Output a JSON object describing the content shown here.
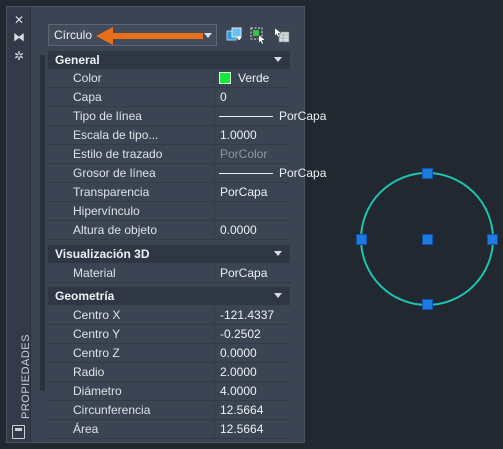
{
  "palette": {
    "title": "PROPIEDADES",
    "selector": {
      "value": "Círculo"
    },
    "toolbar_icons": [
      "close-icon",
      "auto-hide-icon",
      "settings-icon",
      "quick-select-icon",
      "select-objects-icon",
      "toggle-pickadd-icon"
    ],
    "sections": [
      {
        "label": "General",
        "rows": [
          {
            "name": "Color",
            "value": "Verde"
          },
          {
            "name": "Capa",
            "value": "0"
          },
          {
            "name": "Tipo de línea",
            "value": "PorCapa"
          },
          {
            "name": "Escala de tipo...",
            "value": "1.0000"
          },
          {
            "name": "Estilo de trazado",
            "value": "PorColor"
          },
          {
            "name": "Grosor de línea",
            "value": "PorCapa"
          },
          {
            "name": "Transparencia",
            "value": "PorCapa"
          },
          {
            "name": "Hipervínculo",
            "value": ""
          },
          {
            "name": "Altura de objeto",
            "value": "0.0000"
          }
        ]
      },
      {
        "label": "Visualización 3D",
        "rows": [
          {
            "name": "Material",
            "value": "PorCapa"
          }
        ]
      },
      {
        "label": "Geometría",
        "rows": [
          {
            "name": "Centro X",
            "value": "-121.4337"
          },
          {
            "name": "Centro Y",
            "value": "-0.2502"
          },
          {
            "name": "Centro Z",
            "value": "0.0000"
          },
          {
            "name": "Radio",
            "value": "2.0000"
          },
          {
            "name": "Diámetro",
            "value": "4.0000"
          },
          {
            "name": "Circunferencia",
            "value": "12.5664"
          },
          {
            "name": "Área",
            "value": "12.5664"
          }
        ]
      }
    ]
  },
  "colors": {
    "circle": "#1ec2b0",
    "grip": "#1f7ae0",
    "callout_arrow": "#e8701a",
    "color_swatch": "#19e53c"
  }
}
